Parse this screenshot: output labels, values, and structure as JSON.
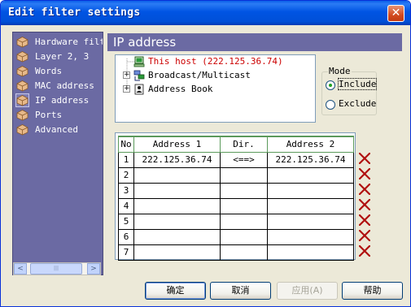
{
  "window": {
    "title": "Edit filter settings",
    "close_glyph": "✕"
  },
  "nav": {
    "items": [
      {
        "label": "Hardware filte",
        "icon": "package-icon",
        "selected": false
      },
      {
        "label": "Layer 2, 3",
        "icon": "package-icon",
        "selected": false
      },
      {
        "label": "Words",
        "icon": "package-icon",
        "selected": false
      },
      {
        "label": "MAC address",
        "icon": "package-icon",
        "selected": false
      },
      {
        "label": "IP address",
        "icon": "package-icon",
        "selected": true
      },
      {
        "label": "Ports",
        "icon": "package-icon",
        "selected": false
      },
      {
        "label": "Advanced",
        "icon": "package-icon",
        "selected": false
      }
    ],
    "scroll_left": "<",
    "scroll_right": ">",
    "scroll_grip": "|||"
  },
  "header": {
    "title": "IP address"
  },
  "tree": {
    "items": [
      {
        "label": "This host (222.125.36.74)",
        "icon": "computer-icon",
        "expander": "",
        "color": "#cc0000"
      },
      {
        "label": "Broadcast/Multicast",
        "icon": "network-icon",
        "expander": "+",
        "color": "#000000"
      },
      {
        "label": "Address Book",
        "icon": "address-book-icon",
        "expander": "+",
        "color": "#000000"
      }
    ]
  },
  "mode": {
    "legend": "Mode",
    "options": [
      {
        "label": "Include",
        "selected": true
      },
      {
        "label": "Exclude",
        "selected": false
      }
    ]
  },
  "table": {
    "headers": {
      "no": "No",
      "address1": "Address 1",
      "dir": "Dir.",
      "address2": "Address 2"
    },
    "rows": [
      {
        "no": "1",
        "address1": "222.125.36.74",
        "dir": "<==>",
        "address2": "222.125.36.74"
      },
      {
        "no": "2",
        "address1": "",
        "dir": "",
        "address2": ""
      },
      {
        "no": "3",
        "address1": "",
        "dir": "",
        "address2": ""
      },
      {
        "no": "4",
        "address1": "",
        "dir": "",
        "address2": ""
      },
      {
        "no": "5",
        "address1": "",
        "dir": "",
        "address2": ""
      },
      {
        "no": "6",
        "address1": "",
        "dir": "",
        "address2": ""
      },
      {
        "no": "7",
        "address1": "",
        "dir": "",
        "address2": ""
      }
    ],
    "delete_icon": "delete-x-icon",
    "value_color": "#cc0000"
  },
  "buttons": {
    "ok": "确定",
    "cancel": "取消",
    "apply": "应用(A)",
    "help": "帮助"
  },
  "colors": {
    "title_bar": "#0054e3",
    "panel": "#6b6aa3",
    "dialog_bg": "#ece9d8",
    "delete_red": "#b01010"
  }
}
